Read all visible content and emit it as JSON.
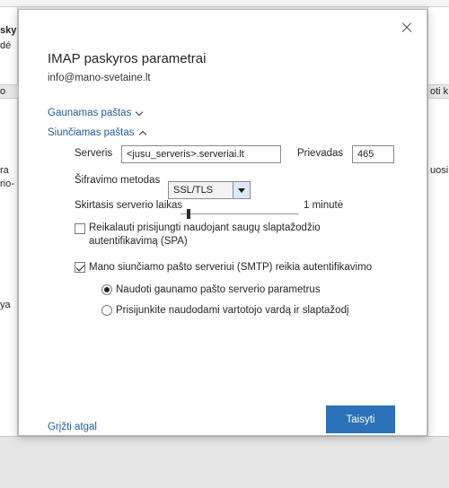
{
  "background": {
    "fragments_left": [
      "sky",
      "dé",
      "o",
      "ra",
      "rio-",
      "ya"
    ],
    "fragments_right": [
      "oti k",
      "uosi"
    ]
  },
  "dialog": {
    "title": "IMAP paskyros parametrai",
    "email": "info@mano-svetaine.lt",
    "incoming_link": "Gaunamas paštas",
    "outgoing_link": "Siunčiamas paštas",
    "server_label": "Serveris",
    "server_value": "<jusu_serveris>.serveriai.lt",
    "port_label": "Prievadas",
    "port_value": "465",
    "encryption_label": "Šifravimo metodas",
    "encryption_value": "SSL/TLS",
    "timeout_label": "Skirtasis serverio laikas",
    "timeout_value": "1 minutė",
    "spa_checkbox_label_line1": "Reikalauti prisijungti naudojant saugų slaptažodžio",
    "spa_checkbox_label_line2": "autentifikavimą (SPA)",
    "spa_checked": false,
    "smtp_auth_label": "Mano siunčiamo pašto serveriui (SMTP) reikia autentifikavimo",
    "smtp_auth_checked": true,
    "radio_incoming_settings": "Naudoti gaunamo pašto serverio parametrus",
    "radio_login_with": "Prisijunkite naudodami vartotojo vardą ir slaptažodį",
    "back_link": "Grįžti atgal",
    "submit_button": "Taisyti"
  },
  "colors": {
    "link": "#1f5e9c",
    "primary": "#2a71b8",
    "dropdown_button": "#dde9f6"
  },
  "icons": {
    "close": "close-icon",
    "chevron_incoming": "chevron-down-icon",
    "chevron_outgoing": "chevron-up-icon",
    "select_arrow": "triangle-down-icon"
  }
}
